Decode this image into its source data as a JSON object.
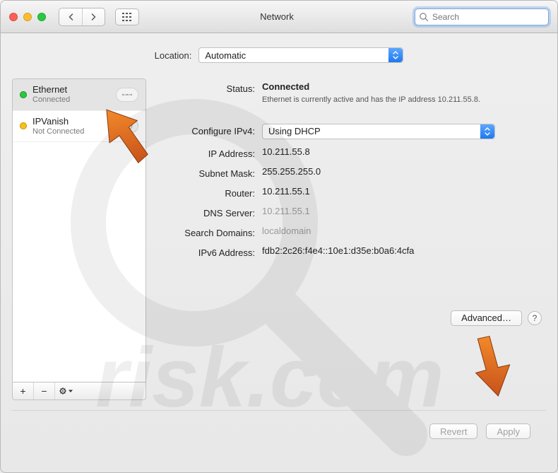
{
  "window": {
    "title": "Network"
  },
  "titlebar": {
    "search_placeholder": "Search"
  },
  "location": {
    "label": "Location:",
    "value": "Automatic"
  },
  "sidebar": {
    "items": [
      {
        "name": "Ethernet",
        "sub": "Connected",
        "status": "green"
      },
      {
        "name": "IPVanish",
        "sub": "Not Connected",
        "status": "yellow"
      }
    ],
    "buttons": {
      "add": "+",
      "remove": "−",
      "action": "⚙︎▾"
    }
  },
  "details": {
    "status_label": "Status:",
    "status_value": "Connected",
    "status_desc": "Ethernet is currently active and has the IP address 10.211.55.8.",
    "config_label": "Configure IPv4:",
    "config_value": "Using DHCP",
    "ip_label": "IP Address:",
    "ip_value": "10.211.55.8",
    "mask_label": "Subnet Mask:",
    "mask_value": "255.255.255.0",
    "router_label": "Router:",
    "router_value": "10.211.55.1",
    "dns_label": "DNS Server:",
    "dns_value": "10.211.55.1",
    "domains_label": "Search Domains:",
    "domains_value": "localdomain",
    "ipv6_label": "IPv6 Address:",
    "ipv6_value": "fdb2:2c26:f4e4::10e1:d35e:b0a6:4cfa",
    "advanced": "Advanced…",
    "help": "?"
  },
  "footer": {
    "revert": "Revert",
    "apply": "Apply"
  },
  "colors": {
    "accent": "#2f7bf0",
    "green": "#2fc540",
    "yellow": "#f5c21b",
    "arrow": "#e06a1b"
  }
}
